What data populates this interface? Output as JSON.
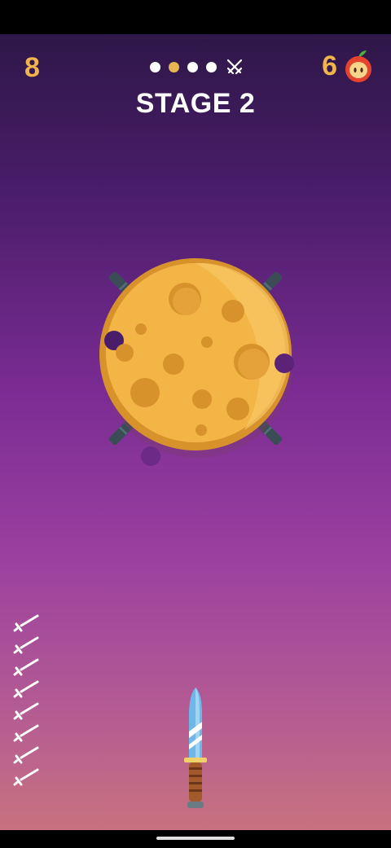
{
  "hud": {
    "score": "8",
    "apples": "6",
    "stage_title": "STAGE 2"
  },
  "stage_progress": {
    "dots": [
      {
        "state": "done"
      },
      {
        "state": "current"
      },
      {
        "state": "upcoming"
      },
      {
        "state": "upcoming"
      }
    ],
    "boss_icon": "crossed-swords-icon"
  },
  "target": {
    "type": "cheese-wheel",
    "stuck_knives": 4
  },
  "knives_remaining": 8,
  "colors": {
    "accent": "#f0b44c",
    "cheese": "#f3b545",
    "cheese_dark": "#d8922c",
    "background_top": "#2e1748",
    "background_bottom": "#c8727f"
  }
}
